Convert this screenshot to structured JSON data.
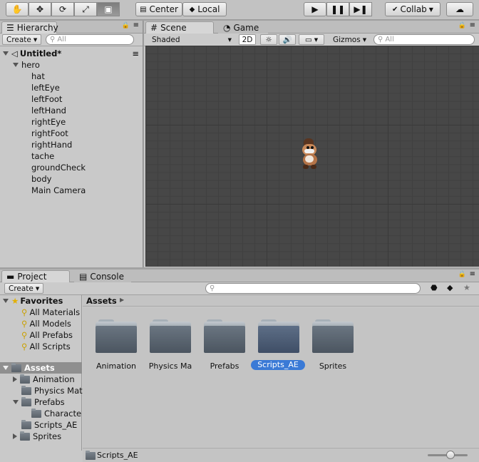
{
  "toolbar": {
    "transform_tools": [
      "hand-tool",
      "move-tool",
      "rotate-tool",
      "scale-tool",
      "rect-tool"
    ],
    "pivot_label": "Center",
    "space_label": "Local",
    "collab_label": "Collab",
    "play_controls": [
      "play-icon",
      "pause-icon",
      "step-icon"
    ]
  },
  "hierarchy": {
    "tab_label": "Hierarchy",
    "create_label": "Create",
    "search_placeholder": "All",
    "scene_name": "Untitled*",
    "root": "hero",
    "children": [
      "hat",
      "leftEye",
      "leftFoot",
      "leftHand",
      "rightEye",
      "rightFoot",
      "rightHand",
      "tache",
      "groundCheck",
      "body",
      "Main Camera"
    ]
  },
  "scene_view": {
    "tabs": [
      "Scene",
      "Game"
    ],
    "shading_mode": "Shaded",
    "mode_2d": "2D",
    "gizmos_label": "Gizmos",
    "search_placeholder": "All"
  },
  "project": {
    "tabs": [
      "Project",
      "Console"
    ],
    "create_label": "Create",
    "favorites_label": "Favorites",
    "favorites": [
      "All Materials",
      "All Models",
      "All Prefabs",
      "All Scripts"
    ],
    "assets_label": "Assets",
    "tree": [
      {
        "label": "Animation",
        "level": 1,
        "arrow": "right"
      },
      {
        "label": "Physics Mat",
        "level": 1,
        "arrow": ""
      },
      {
        "label": "Prefabs",
        "level": 1,
        "arrow": "down"
      },
      {
        "label": "Characte",
        "level": 2,
        "arrow": ""
      },
      {
        "label": "Scripts_AE",
        "level": 1,
        "arrow": ""
      },
      {
        "label": "Sprites",
        "level": 1,
        "arrow": "right"
      }
    ],
    "breadcrumb": "Assets",
    "folders": [
      "Animation",
      "Physics Ma",
      "Prefabs",
      "Scripts_AE",
      "Sprites"
    ],
    "selected_folder": "Scripts_AE",
    "status_path": "Scripts_AE"
  }
}
